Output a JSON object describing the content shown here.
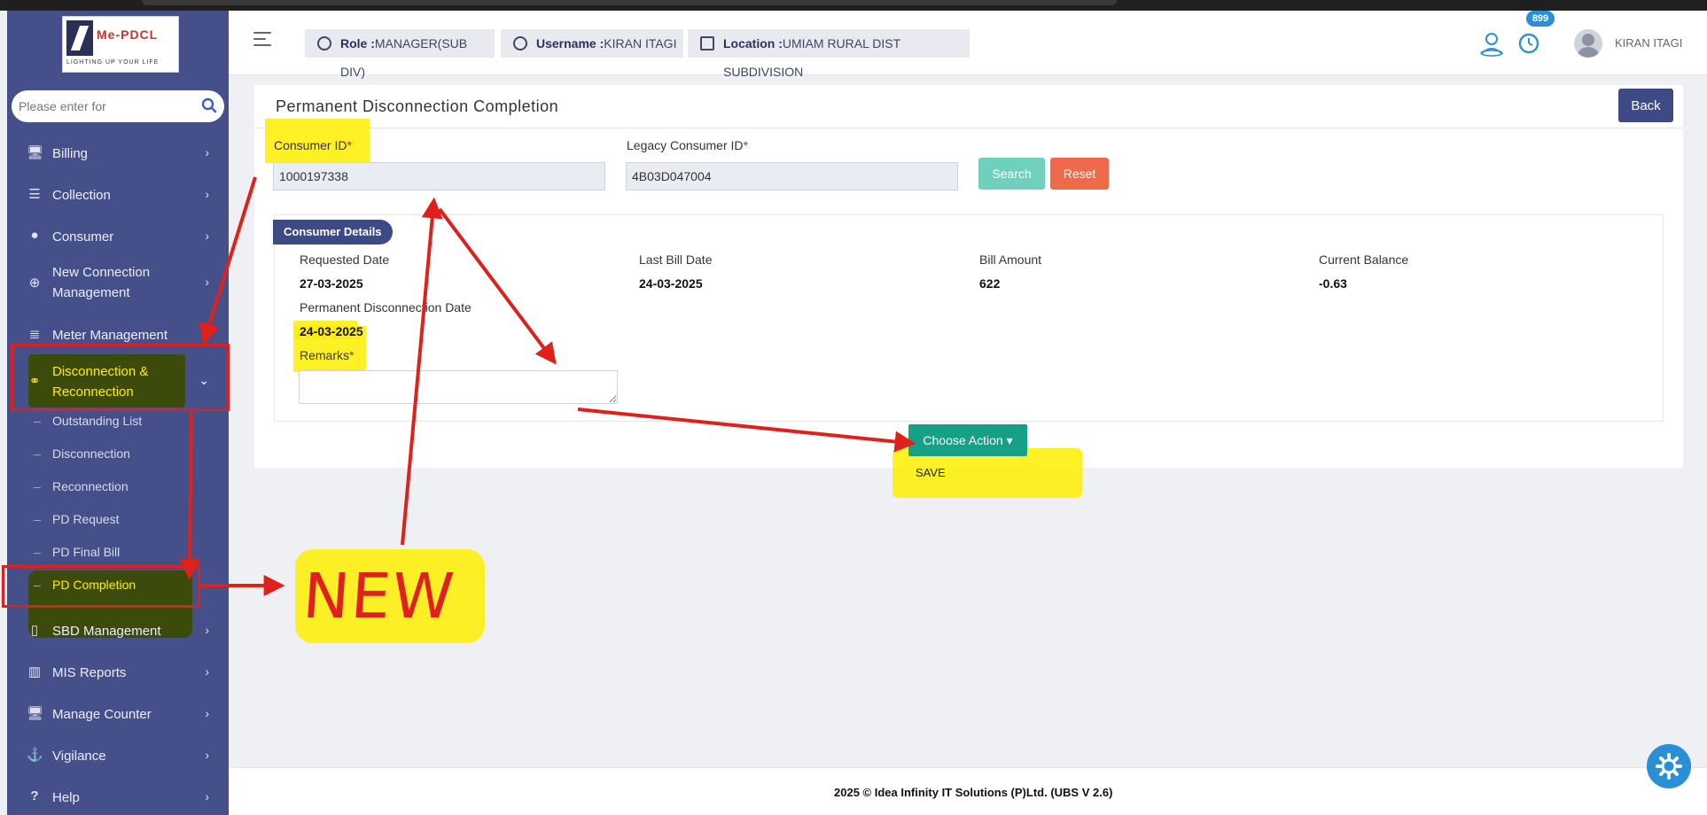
{
  "app": {
    "logo_brand": "Me-PDCL",
    "logo_tagline": "LIGHTING UP YOUR LIFE"
  },
  "sidebar": {
    "search_placeholder": "Please enter for",
    "items": [
      {
        "label": "Billing"
      },
      {
        "label": "Collection"
      },
      {
        "label": "Consumer"
      },
      {
        "label": "New Connection Management"
      },
      {
        "label": "Meter Management"
      },
      {
        "label": "Disconnection & Reconnection"
      },
      {
        "label": "SBD Management"
      },
      {
        "label": "MIS Reports"
      },
      {
        "label": "Manage Counter"
      },
      {
        "label": "Vigilance"
      },
      {
        "label": "Help"
      }
    ],
    "sub_items": [
      {
        "label": "Outstanding List"
      },
      {
        "label": "Disconnection"
      },
      {
        "label": "Reconnection"
      },
      {
        "label": "PD Request"
      },
      {
        "label": "PD Final Bill"
      },
      {
        "label": "PD Completion"
      }
    ]
  },
  "header": {
    "role_key": "Role :",
    "role_value": "MANAGER(SUB DIV)",
    "username_key": "Username :",
    "username_value": "KIRAN ITAGI",
    "location_key": "Location :",
    "location_value": "UMIAM RURAL DIST SUBDIVISION",
    "notification_count": "899",
    "user_name": "KIRAN ITAGI"
  },
  "page": {
    "title": "Permanent Disconnection Completion",
    "back_label": "Back",
    "consumer_id_label": "Consumer ID",
    "consumer_id_value": "1000197338",
    "legacy_id_label": "Legacy Consumer ID",
    "legacy_id_value": "4B03D047004",
    "required_mark": "*",
    "search_label": "Search",
    "reset_label": "Reset",
    "details_title": "Consumer Details",
    "requested_date_label": "Requested Date",
    "requested_date_value": "27-03-2025",
    "last_bill_date_label": "Last Bill Date",
    "last_bill_date_value": "24-03-2025",
    "bill_amount_label": "Bill Amount",
    "bill_amount_value": "622",
    "current_balance_label": "Current Balance",
    "current_balance_value": "-0.63",
    "pd_date_label": "Permanent Disconnection Date",
    "pd_date_value": "24-03-2025",
    "remarks_label": "Remarks",
    "choose_action_label": "Choose Action",
    "action_option": "SAVE"
  },
  "annotation": {
    "new_label": "NEW"
  },
  "footer": {
    "text": "2025 © Idea Infinity IT Solutions (P)Ltd. (UBS V 2.6)"
  },
  "colors": {
    "sidebar": "#45508a",
    "primary": "#3d4a85",
    "highlight": "#ffee00",
    "annotation_red": "#e0201b",
    "teal": "#16a085"
  }
}
